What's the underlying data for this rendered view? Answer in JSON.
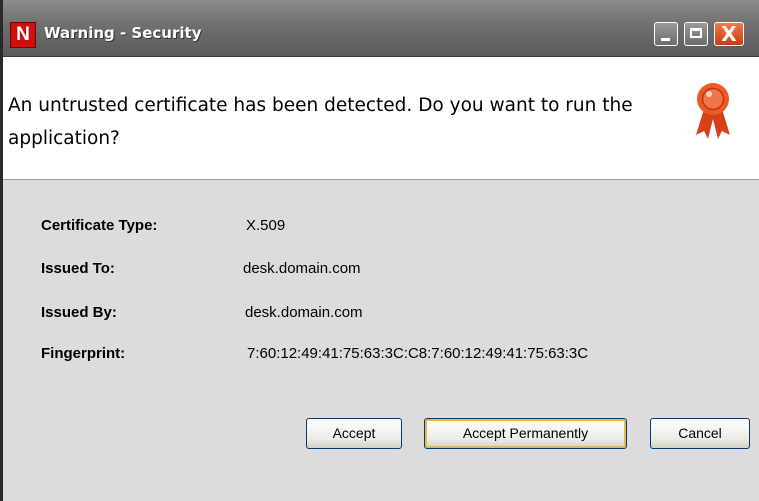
{
  "window": {
    "title": "Warning - Security",
    "logo_letter": "N",
    "close_glyph": "X"
  },
  "header": {
    "message": "An untrusted certificate has been detected.  Do you want to run the application?",
    "icon": "ribbon-award-icon"
  },
  "details": [
    {
      "label": "Certificate Type:",
      "value": "X.509"
    },
    {
      "label": "Issued To:",
      "value": "desk.domain.com"
    },
    {
      "label": "Issued By:",
      "value": "desk.domain.com"
    },
    {
      "label": "Fingerprint:",
      "value": "7:60:12:49:41:75:63:3C:C8:7:60:12:49:41:75:63:3C"
    }
  ],
  "buttons": {
    "accept": "Accept",
    "accept_permanently": "Accept Permanently",
    "cancel": "Cancel"
  },
  "colors": {
    "logo": "#d01010",
    "close_button": "#e05a2a",
    "ribbon": "#e8481c"
  }
}
